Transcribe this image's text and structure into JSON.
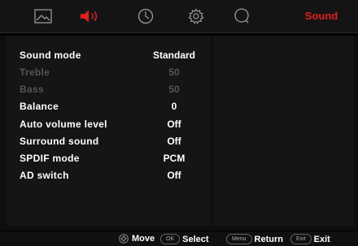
{
  "header": {
    "tabs": [
      {
        "icon": "picture-icon",
        "active": false
      },
      {
        "icon": "sound-icon",
        "active": true
      },
      {
        "icon": "clock-icon",
        "active": false
      },
      {
        "icon": "gear-icon",
        "active": false
      },
      {
        "icon": "search-icon",
        "active": false
      }
    ],
    "section_title": "Sound"
  },
  "menu": {
    "items": [
      {
        "label": "Sound mode",
        "value": "Standard",
        "enabled": true
      },
      {
        "label": "Treble",
        "value": "50",
        "enabled": false
      },
      {
        "label": "Bass",
        "value": "50",
        "enabled": false
      },
      {
        "label": "Balance",
        "value": "0",
        "enabled": true
      },
      {
        "label": "Auto volume level",
        "value": "Off",
        "enabled": true
      },
      {
        "label": "Surround sound",
        "value": "Off",
        "enabled": true
      },
      {
        "label": "SPDIF mode",
        "value": "PCM",
        "enabled": true
      },
      {
        "label": "AD switch",
        "value": "Off",
        "enabled": true
      }
    ]
  },
  "footer": {
    "move": "Move",
    "select_key": "OK",
    "select": "Select",
    "return_key": "Menu",
    "return": "Return",
    "exit_key": "Exit",
    "exit": "Exit"
  },
  "colors": {
    "accent": "#e02020",
    "icon_inactive": "#9a9a9a",
    "disabled_text": "#555555"
  }
}
